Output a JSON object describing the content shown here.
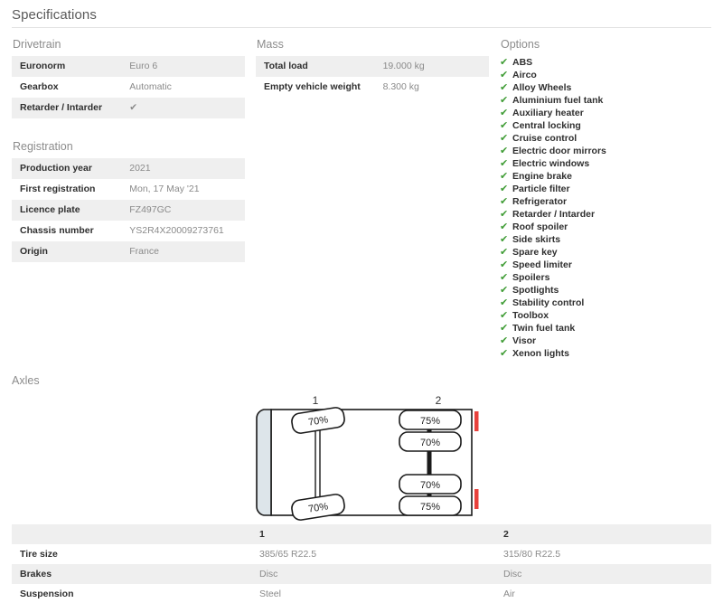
{
  "page": {
    "title": "Specifications"
  },
  "drivetrain": {
    "heading": "Drivetrain",
    "rows": [
      {
        "key": "Euronorm",
        "value": "Euro 6",
        "type": "text"
      },
      {
        "key": "Gearbox",
        "value": "Automatic",
        "type": "text"
      },
      {
        "key": "Retarder / Intarder",
        "value": "✔",
        "type": "check"
      }
    ]
  },
  "registration": {
    "heading": "Registration",
    "rows": [
      {
        "key": "Production year",
        "value": "2021",
        "type": "text"
      },
      {
        "key": "First registration",
        "value": "Mon, 17 May '21",
        "type": "text"
      },
      {
        "key": "Licence plate",
        "value": "FZ497GC",
        "type": "text"
      },
      {
        "key": "Chassis number",
        "value": "YS2R4X20009273761",
        "type": "text"
      },
      {
        "key": "Origin",
        "value": "France",
        "type": "text"
      }
    ]
  },
  "mass": {
    "heading": "Mass",
    "rows": [
      {
        "key": "Total load",
        "value": "19.000 kg",
        "type": "text"
      },
      {
        "key": "Empty vehicle weight",
        "value": "8.300 kg",
        "type": "text"
      }
    ]
  },
  "options": {
    "heading": "Options",
    "check_glyph": "✔",
    "items": [
      "ABS",
      "Airco",
      "Alloy Wheels",
      "Aluminium fuel tank",
      "Auxiliary heater",
      "Central locking",
      "Cruise control",
      "Electric door mirrors",
      "Electric windows",
      "Engine brake",
      "Particle filter",
      "Refrigerator",
      "Retarder / Intarder",
      "Roof spoiler",
      "Side skirts",
      "Spare key",
      "Speed limiter",
      "Spoilers",
      "Spotlights",
      "Stability control",
      "Toolbox",
      "Twin fuel tank",
      "Visor",
      "Xenon lights"
    ]
  },
  "axles": {
    "heading": "Axles",
    "diagram": {
      "axle_labels": [
        {
          "id": "1",
          "label": "1"
        },
        {
          "id": "2",
          "label": "2"
        }
      ],
      "tire_tread": [
        {
          "axle": "1",
          "position": "left-front",
          "value": "70%"
        },
        {
          "axle": "1",
          "position": "left-rear",
          "value": "70%"
        },
        {
          "axle": "2",
          "position": "right-outer-top",
          "value": "75%"
        },
        {
          "axle": "2",
          "position": "right-inner-top",
          "value": "70%"
        },
        {
          "axle": "2",
          "position": "right-inner-bottom",
          "value": "70%"
        },
        {
          "axle": "2",
          "position": "right-outer-bottom",
          "value": "75%"
        }
      ],
      "cab_fill": "#dde5ea",
      "marker_color": "#e8413c"
    },
    "table": {
      "columns": [
        "",
        "1",
        "2"
      ],
      "rows": [
        {
          "key": "Tire size",
          "values": [
            "385/65 R22.5",
            "315/80 R22.5"
          ]
        },
        {
          "key": "Brakes",
          "values": [
            "Disc",
            "Disc"
          ]
        },
        {
          "key": "Suspension",
          "values": [
            "Steel",
            "Air"
          ]
        }
      ]
    }
  },
  "colors": {
    "row_stripe": "#efefef",
    "check_green": "#3f9c35",
    "heading_grey": "#8c8c8c",
    "value_grey": "#8a8a8a"
  }
}
